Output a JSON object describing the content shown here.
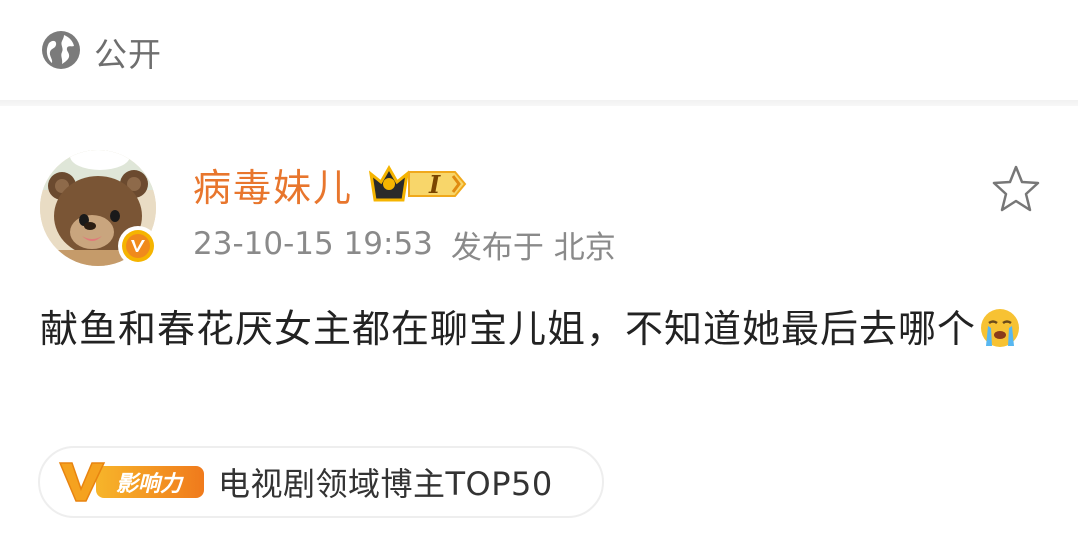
{
  "visibility": {
    "icon": "globe-icon",
    "label": "公开"
  },
  "post": {
    "author": {
      "name": "病毒妹儿",
      "avatar_icon": "bear-avatar",
      "verified_icon": "verified-v-badge",
      "level_badge_text": "I"
    },
    "timestamp": "23-10-15 19:53",
    "source": "发布于 北京",
    "text": "献鱼和春花厌女主都在聊宝儿姐，不知道她最后去哪个",
    "emoji_icon": "crying-emoji",
    "favorite_icon": "star-outline-icon"
  },
  "influence": {
    "logo_letter": "V",
    "logo_text": "影响力",
    "label": "电视剧领域博主TOP50"
  },
  "colors": {
    "username": "#e8762d",
    "meta": "#8a8a8a",
    "body_text": "#222222",
    "accent_gold": "#f5b400",
    "badge_orange": "#f08a1c"
  }
}
